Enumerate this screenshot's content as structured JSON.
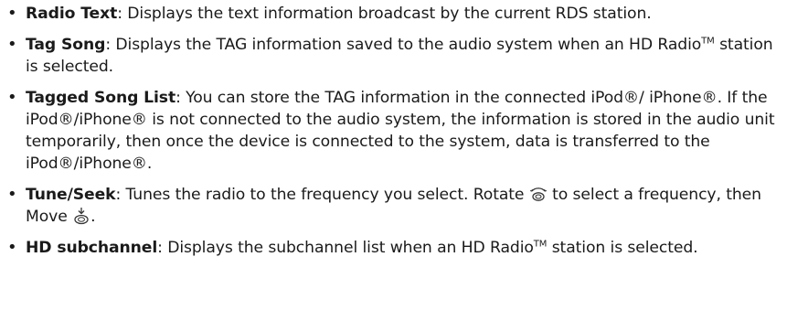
{
  "items": [
    {
      "term": "Radio Text",
      "description": ": Displays the text information broadcast by the current RDS station."
    },
    {
      "term": "Tag Song",
      "description_before_tm": ": Displays the TAG information saved to the audio system when an HD Radio",
      "tm": "TM",
      "description_after_tm": " station is selected."
    },
    {
      "term": "Tagged Song List",
      "description": ": You can store the TAG information in the connected iPod®/ iPhone®. If the iPod®/iPhone® is not connected to the audio system, the information is stored in the audio unit temporarily, then once the device is connected to the system, data is transferred to the iPod®/iPhone®."
    },
    {
      "term": "Tune/Seek",
      "description_part1": ": Tunes the radio to the frequency you select. Rotate",
      "icon1": "rotate-dial-icon",
      "description_part2": "to select a frequency, then Move",
      "icon2": "move-down-dial-icon",
      "description_part3": "."
    },
    {
      "term": "HD subchannel",
      "description_before_tm": ": Displays the subchannel list when an HD Radio",
      "tm": "TM",
      "description_after_tm": " station is selected."
    }
  ],
  "bullet_char": "•"
}
